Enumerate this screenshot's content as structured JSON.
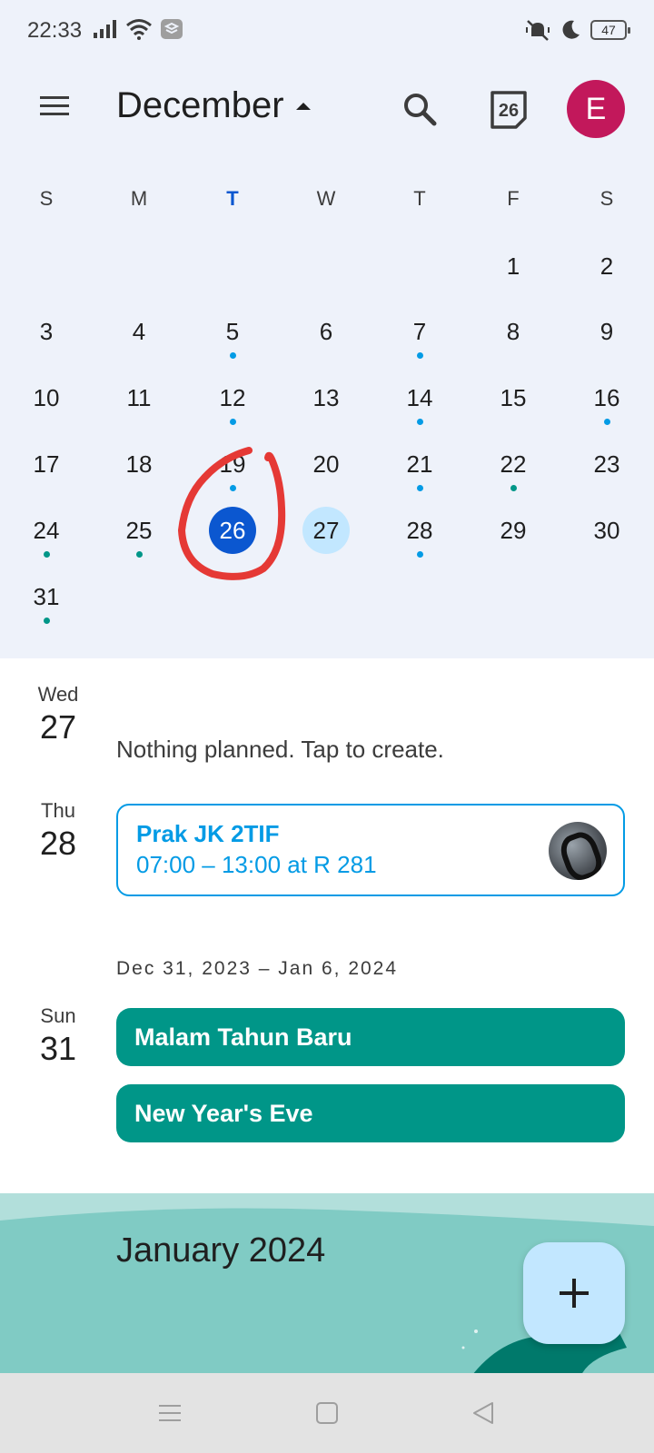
{
  "status_bar": {
    "time": "22:33",
    "battery": "47",
    "icons_left": [
      "signal-icon",
      "wifi-icon",
      "app-notification-icon"
    ],
    "icons_right": [
      "vibrate-off-icon",
      "do-not-disturb-moon-icon",
      "battery-icon"
    ]
  },
  "app_bar": {
    "month": "December",
    "today_icon_number": "26",
    "avatar_letter": "E",
    "colors": {
      "avatar": "#c2185b"
    }
  },
  "calendar": {
    "weekdays": [
      "S",
      "M",
      "T",
      "W",
      "T",
      "F",
      "S"
    ],
    "today_weekday_index": 2,
    "selected_day": "26",
    "highlighted_day": "27",
    "weeks": [
      [
        "",
        "",
        "",
        "",
        "",
        "1",
        "2"
      ],
      [
        "3",
        "4",
        "5",
        "6",
        "7",
        "8",
        "9"
      ],
      [
        "10",
        "11",
        "12",
        "13",
        "14",
        "15",
        "16"
      ],
      [
        "17",
        "18",
        "19",
        "20",
        "21",
        "22",
        "23"
      ],
      [
        "24",
        "25",
        "26",
        "27",
        "28",
        "29",
        "30"
      ],
      [
        "31",
        "",
        "",
        "",
        "",
        "",
        ""
      ]
    ],
    "event_dots": {
      "5": "blue",
      "7": "blue",
      "12": "blue",
      "14": "blue",
      "16": "blue",
      "19": "blue",
      "21": "blue",
      "22": "teal",
      "24": "teal",
      "25": "teal",
      "28": "blue",
      "31": "teal"
    },
    "colors": {
      "selected": "#0b57d0",
      "highlight": "#c2e7ff",
      "blue_dot": "#039be5",
      "teal_dot": "#009688",
      "annotation": "#e53935"
    }
  },
  "agenda": {
    "day1": {
      "dow": "Wed",
      "num": "27",
      "empty_text": "Nothing planned. Tap to create."
    },
    "day2": {
      "dow": "Thu",
      "num": "28",
      "event": {
        "title": "Prak JK 2TIF",
        "time": "07:00 – 13:00 at R 281"
      }
    },
    "week_range": "Dec 31, 2023 – Jan 6, 2024",
    "day3": {
      "dow": "Sun",
      "num": "31",
      "events": [
        "Malam Tahun Baru",
        "New Year's Eve"
      ]
    }
  },
  "month_banner": {
    "title": "January 2024"
  },
  "fab": {
    "icon": "plus-icon"
  },
  "nav_bar": {
    "icons": [
      "recents-menu-icon",
      "home-square-icon",
      "back-triangle-icon"
    ]
  }
}
